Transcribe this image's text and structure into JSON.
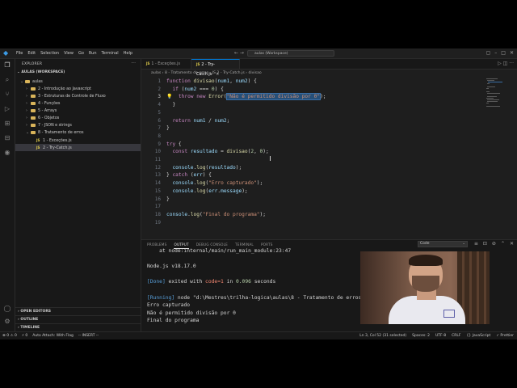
{
  "titlebar": {
    "menu": [
      "File",
      "Edit",
      "Selection",
      "View",
      "Go",
      "Run",
      "Terminal",
      "Help"
    ],
    "search": "aulas (Workspace)"
  },
  "sidebar": {
    "title": "EXPLORER",
    "workspace": "AULAS (WORKSPACE)",
    "items": [
      {
        "label": "aulas",
        "type": "folder",
        "depth": 0
      },
      {
        "label": "2 - Introdução ao Javascript",
        "type": "folder",
        "depth": 1
      },
      {
        "label": "3 - Estruturas de Controle de Fluxo",
        "type": "folder",
        "depth": 1
      },
      {
        "label": "4 - Funções",
        "type": "folder",
        "depth": 1
      },
      {
        "label": "5 - Arrays",
        "type": "folder",
        "depth": 1
      },
      {
        "label": "6 - Objetos",
        "type": "folder",
        "depth": 1
      },
      {
        "label": "7 - JSON e strings",
        "type": "folder",
        "depth": 1
      },
      {
        "label": "8 - Tratamento de erros",
        "type": "folder",
        "depth": 1
      },
      {
        "label": "1 - Exceções.js",
        "type": "js",
        "depth": 2
      },
      {
        "label": "2 - Try-Catch.js",
        "type": "js",
        "depth": 2,
        "selected": true
      }
    ],
    "bottom": [
      "OPEN EDITORS",
      "OUTLINE",
      "TIMELINE"
    ]
  },
  "tabs": [
    {
      "label": "1 - Exceções.js",
      "active": false
    },
    {
      "label": "2 - Try-Catch.js",
      "active": true
    }
  ],
  "breadcrumb": "aulas › 8 - Tratamento de erros › JS 2 - Try-Catch.js › divisao",
  "code_lines": [
    "function divisao(num1, num2) {",
    "  if (num2 === 0) {",
    "    throw new Error(\"Não é permitido divisão por 0\");",
    "  }",
    "",
    "  return num1 / num2;",
    "}",
    "",
    "try {",
    "  const resultado = divisao(2, 0);",
    "",
    "  console.log(resultado);",
    "} catch (err) {",
    "  console.log(\"Erro capturado\");",
    "  console.log(err.message);",
    "}",
    "",
    "console.log(\"Final do programa\");",
    ""
  ],
  "line_numbers": [
    "1",
    "2",
    "3",
    "4",
    "5",
    "6",
    "7",
    "8",
    "9",
    "10",
    "11",
    "12",
    "13",
    "14",
    "15",
    "16",
    "17",
    "18",
    "19"
  ],
  "panel": {
    "tabs": [
      "PROBLEMS",
      "OUTPUT",
      "DEBUG CONSOLE",
      "TERMINAL",
      "PORTS"
    ],
    "active_tab": "OUTPUT",
    "select": "Code",
    "output": [
      "    at node:internal/main/run_main_module:23:47",
      "",
      "Node.js v18.17.0",
      "",
      "[Done] exited with code=1 in 0.096 seconds",
      "",
      "[Running] node \"d:\\Mestres\\trilha-logica\\aulas\\8 - Tratamento de erros\\tempCodeRunnerFile.js\"",
      "Erro capturado",
      "Não é permitido divisão por 0",
      "Final do programa"
    ]
  },
  "status": {
    "left": [
      "⊗ 0 ⚠ 0",
      "⚡ 0",
      "Auto Attach: With Flag",
      "-- INSERT --"
    ],
    "right": [
      "Ln 3, Col 52 (31 selected)",
      "Spaces: 2",
      "UTF-8",
      "CRLF",
      "{} JavaScript",
      "✓ Prettier"
    ]
  }
}
